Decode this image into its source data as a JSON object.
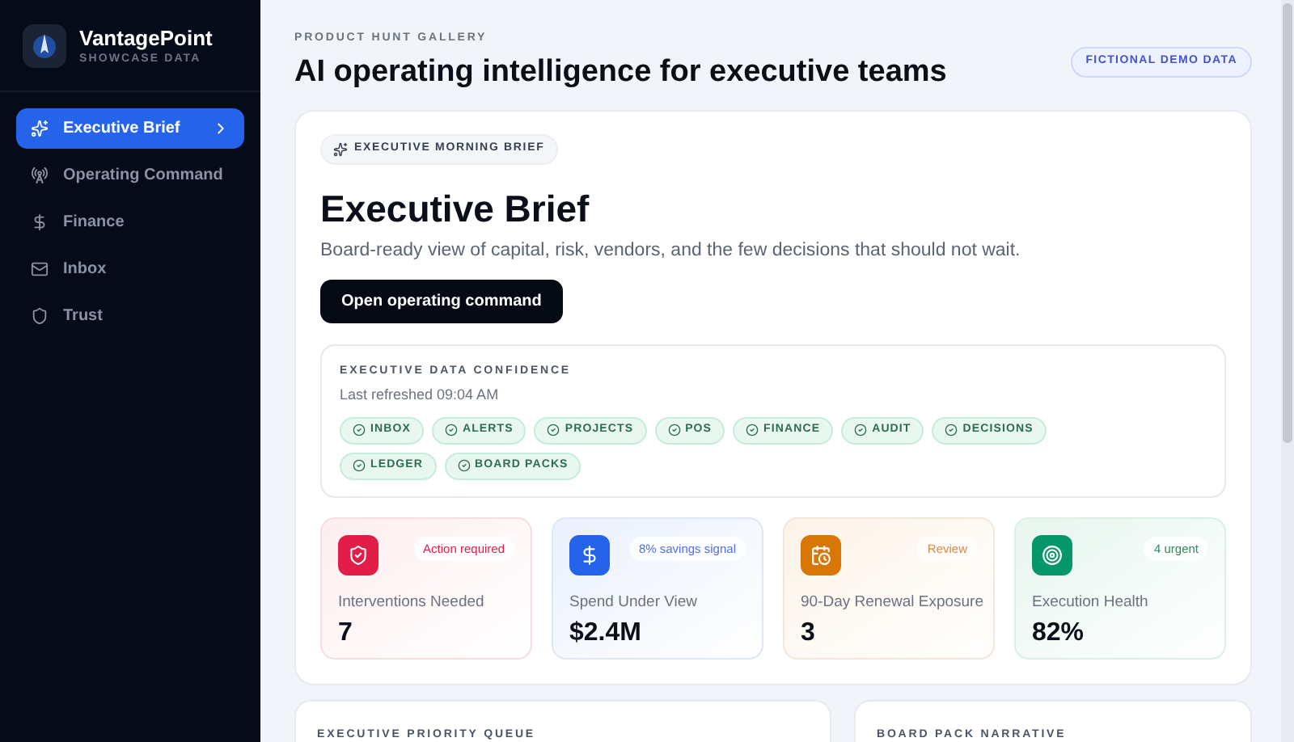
{
  "sidebar": {
    "brand": "VantagePoint",
    "tagline": "SHOWCASE DATA",
    "items": [
      {
        "label": "Executive Brief",
        "selected": true
      },
      {
        "label": "Operating Command",
        "selected": false
      },
      {
        "label": "Finance",
        "selected": false
      },
      {
        "label": "Inbox",
        "selected": false
      },
      {
        "label": "Trust",
        "selected": false
      }
    ]
  },
  "header": {
    "eyebrow": "PRODUCT HUNT GALLERY",
    "title": "AI operating intelligence for executive teams",
    "badge": "FICTIONAL DEMO DATA"
  },
  "brief": {
    "pill": "EXECUTIVE MORNING BRIEF",
    "title": "Executive Brief",
    "subtitle": "Board-ready view of capital, risk, vendors, and the few decisions that should not wait.",
    "button": "Open operating command",
    "confidence": {
      "heading": "EXECUTIVE DATA CONFIDENCE",
      "refreshed": "Last refreshed 09:04 AM",
      "sources": [
        "INBOX",
        "ALERTS",
        "PROJECTS",
        "POS",
        "FINANCE",
        "AUDIT",
        "DECISIONS",
        "LEDGER",
        "BOARD PACKS"
      ]
    },
    "stats": [
      {
        "badge": "Action required",
        "label": "Interventions Needed",
        "value": "7"
      },
      {
        "badge": "8% savings signal",
        "label": "Spend Under View",
        "value": "$2.4M"
      },
      {
        "badge": "Review",
        "label": "90-Day Renewal Exposure",
        "value": "3"
      },
      {
        "badge": "4 urgent",
        "label": "Execution Health",
        "value": "82%"
      }
    ]
  },
  "panels": [
    {
      "heading": "EXECUTIVE PRIORITY QUEUE"
    },
    {
      "heading": "BOARD PACK NARRATIVE"
    }
  ]
}
